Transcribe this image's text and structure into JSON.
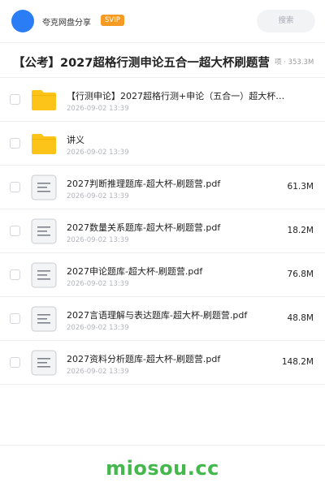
{
  "header": {
    "app_name": "夸克网盘分享",
    "badge": "SVIP",
    "search_label": "搜索",
    "avatar_color": "#2b7df5"
  },
  "share": {
    "title": "【公考】2027超格行测申论五合一超大杯刷题营",
    "meta": "项 · 353.3M"
  },
  "files": [
    {
      "type": "folder",
      "icon": "folder-icon",
      "name": "【行测申论】2027超格行测+申论（五合一）超大杯…",
      "date": "2026-09-02 13:39",
      "size": ""
    },
    {
      "type": "folder",
      "icon": "folder-icon",
      "name": "讲义",
      "date": "2026-09-02 13:39",
      "size": ""
    },
    {
      "type": "file",
      "icon": "document-icon",
      "name": "2027判断推理题库-超大杯-刷题营.pdf",
      "date": "2026-09-02 13:39",
      "size": "61.3M"
    },
    {
      "type": "file",
      "icon": "document-icon",
      "name": "2027数量关系题库-超大杯-刷题营.pdf",
      "date": "2026-09-02 13:39",
      "size": "18.2M"
    },
    {
      "type": "file",
      "icon": "document-icon",
      "name": "2027申论题库-超大杯-刷题营.pdf",
      "date": "2026-09-02 13:39",
      "size": "76.8M"
    },
    {
      "type": "file",
      "icon": "document-icon",
      "name": "2027言语理解与表达题库-超大杯-刷题营.pdf",
      "date": "2026-09-02 13:39",
      "size": "48.8M"
    },
    {
      "type": "file",
      "icon": "document-icon",
      "name": "2027资料分析题库-超大杯-刷题营.pdf",
      "date": "2026-09-02 13:39",
      "size": "148.2M"
    }
  ],
  "watermark": "miosou.cc",
  "colors": {
    "accent": "#2b7df5",
    "badge": "#f59a23",
    "folder": "#fcc419",
    "watermark": "#45b84d"
  }
}
